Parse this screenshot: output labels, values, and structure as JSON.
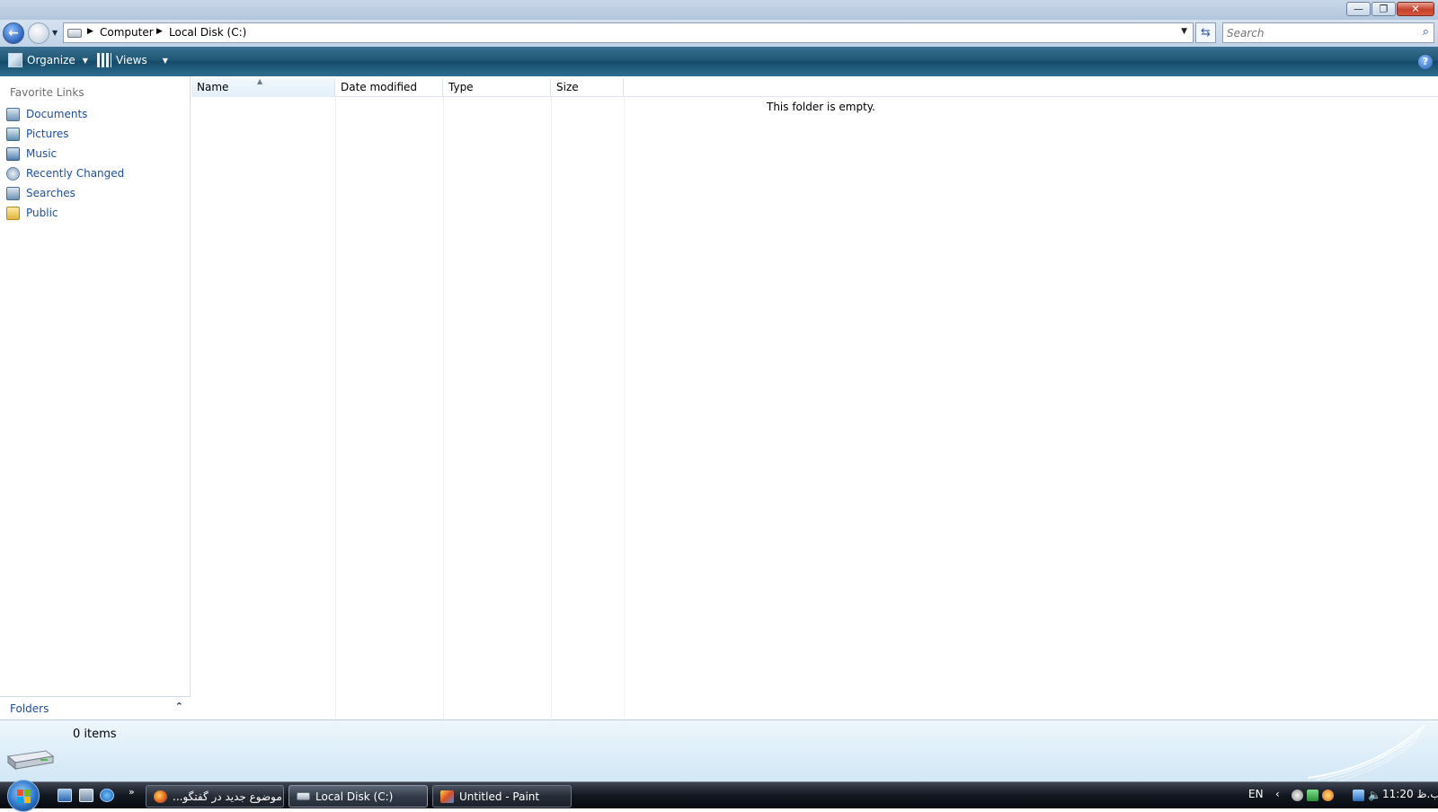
{
  "window": {
    "caption_buttons": {
      "minimize": "—",
      "maximize": "❐",
      "close": "✕"
    }
  },
  "nav": {
    "back_glyph": "←",
    "forward_glyph": "→",
    "history_dropdown_glyph": "▼",
    "breadcrumb": [
      "Computer",
      "Local Disk (C:)"
    ],
    "separator_glyph": "▶",
    "address_dropdown_glyph": "▼",
    "refresh_glyph": "⇆",
    "search_placeholder": "Search",
    "search_glyph": "⌕"
  },
  "toolbar": {
    "organize_label": "Organize",
    "views_label": "Views",
    "dropdown_glyph": "▼",
    "help_glyph": "?"
  },
  "navpane": {
    "favorites_title": "Favorite Links",
    "items": [
      {
        "label": "Documents",
        "icon": "documents-icon"
      },
      {
        "label": "Pictures",
        "icon": "pictures-icon"
      },
      {
        "label": "Music",
        "icon": "music-icon"
      },
      {
        "label": "Recently Changed",
        "icon": "recently-changed-icon"
      },
      {
        "label": "Searches",
        "icon": "searches-icon"
      },
      {
        "label": "Public",
        "icon": "public-folder-icon"
      }
    ],
    "folders_label": "Folders",
    "folders_chevron": "⌃"
  },
  "content": {
    "columns": [
      "Name",
      "Date modified",
      "Type",
      "Size"
    ],
    "sort_glyph": "▲",
    "empty_message": "This folder is empty."
  },
  "details": {
    "item_count": "0 items"
  },
  "taskbar": {
    "quicklaunch_more": "»",
    "tasks": [
      {
        "label": "...موضوع جديد در گفتگو",
        "icon": "firefox-icon"
      },
      {
        "label": "Local Disk (C:)",
        "icon": "drive-icon"
      },
      {
        "label": "Untitled - Paint",
        "icon": "paint-icon"
      }
    ],
    "language": "EN",
    "tray_chevron": "‹",
    "volume_glyph": "🔈",
    "clock": "ب.ظ 11:20"
  },
  "colors": {
    "link_blue": "#1e4fa0",
    "toolbar_teal": "#1f5676",
    "details_bg": "#dcedf8"
  }
}
